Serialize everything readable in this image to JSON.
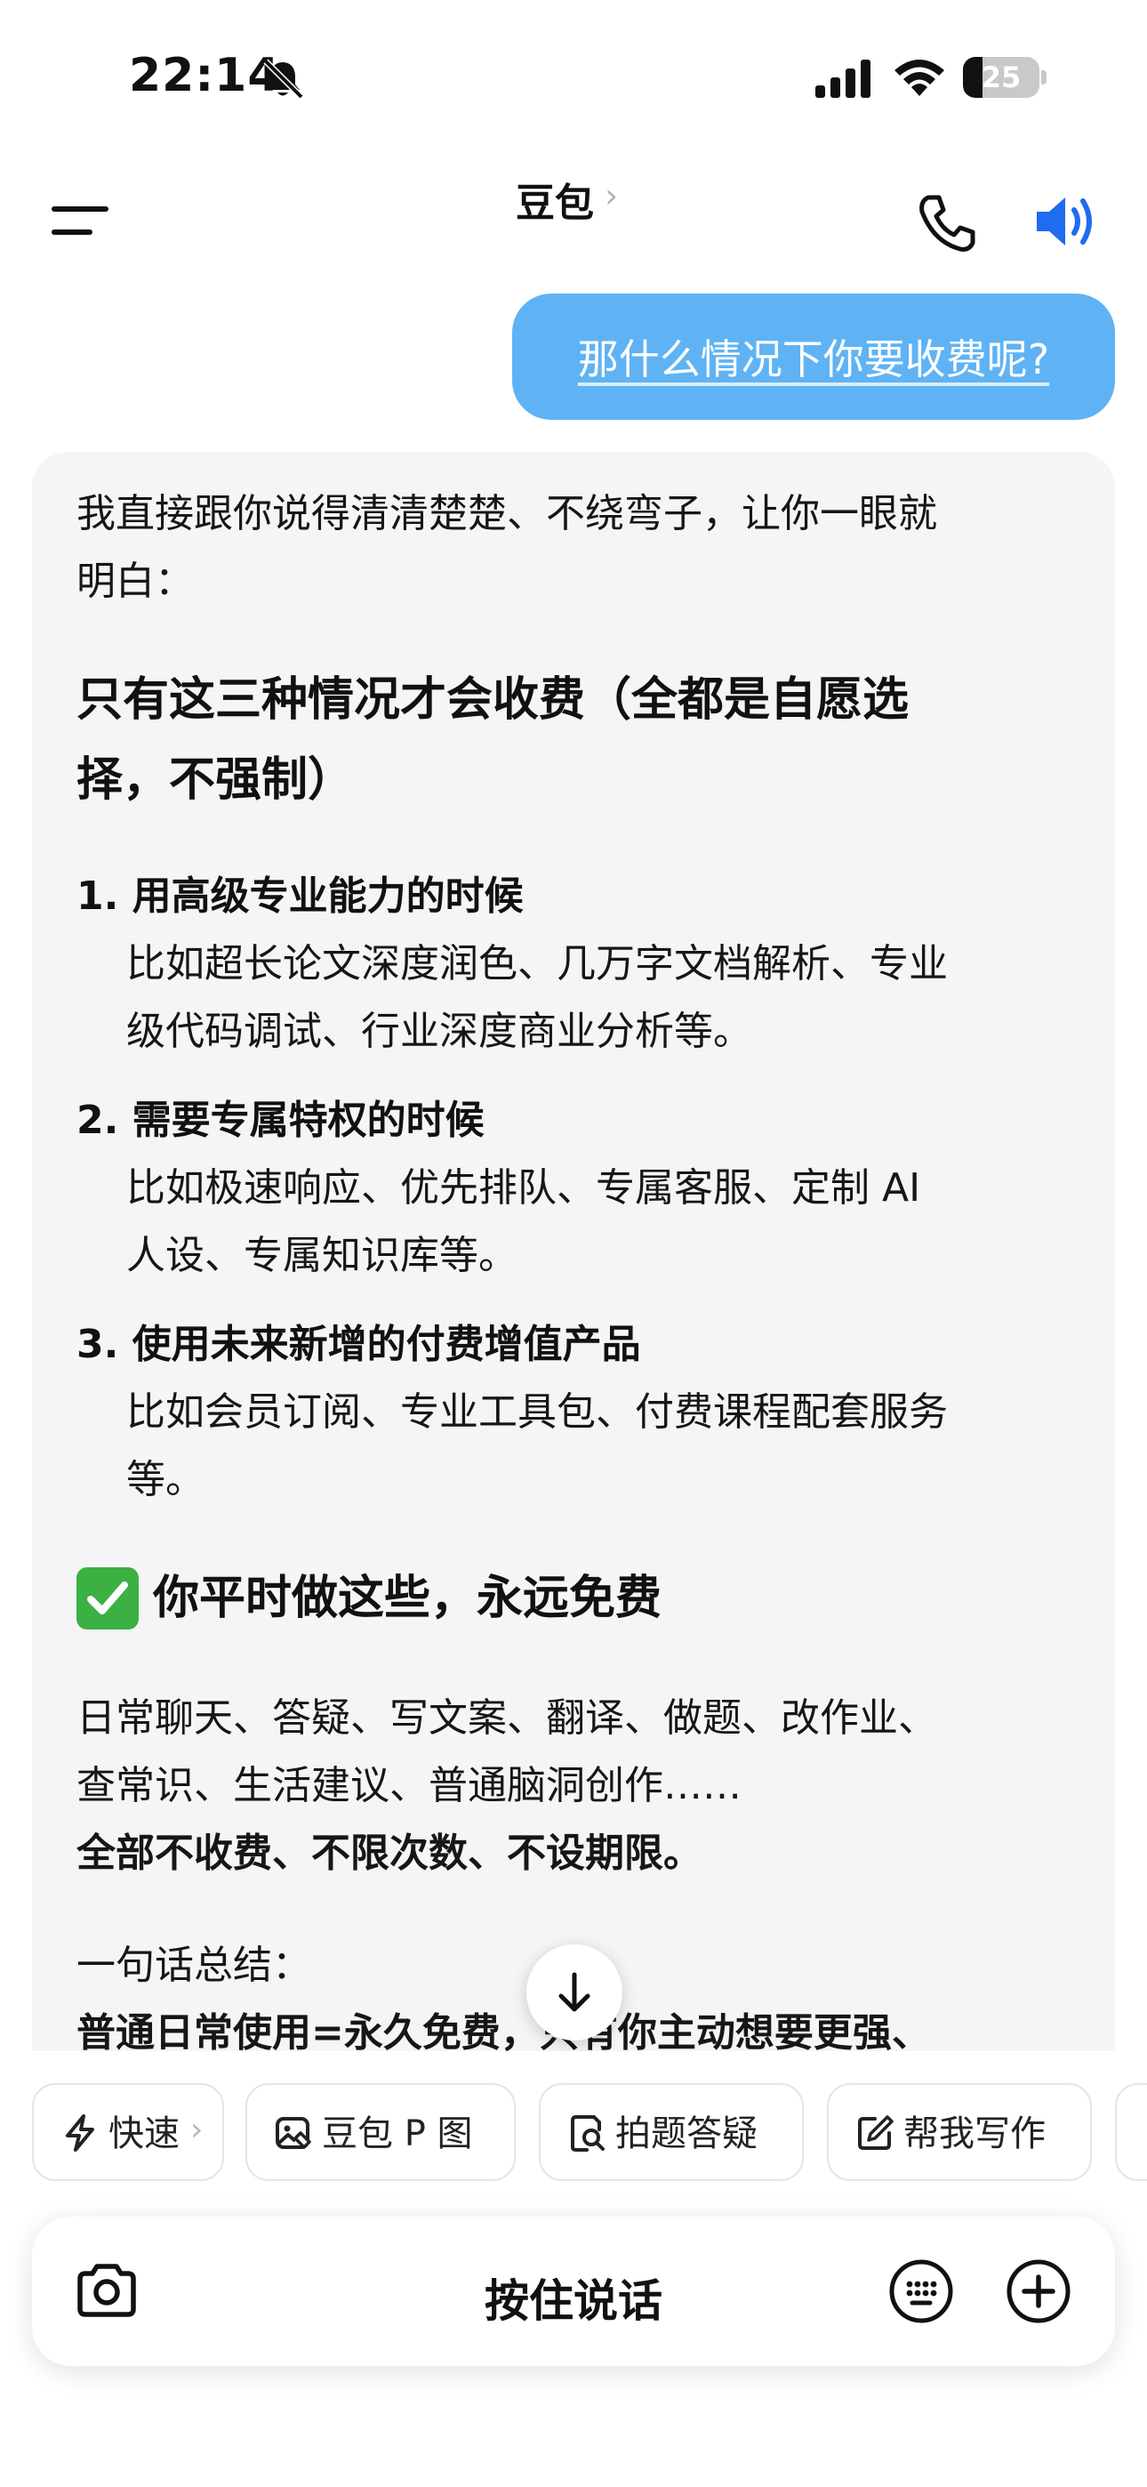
{
  "status_bar": {
    "time": "22:14",
    "battery_level": "25",
    "battery_fraction": 0.25,
    "icons": [
      "bell-off-icon",
      "cellular-signal-icon",
      "wifi-icon",
      "battery-icon"
    ]
  },
  "header": {
    "title": "豆包",
    "chevron": "›",
    "icons": [
      "menu-icon",
      "phone-icon",
      "speaker-icon"
    ],
    "accent_color": "#1e6cf0"
  },
  "user_message": {
    "text": "那什么情况下你要收费呢?",
    "bubble_color": "#5fb3f4"
  },
  "reply": {
    "intro_line1": "我直接跟你说得清清楚楚、不绕弯子，让你一眼就",
    "intro_line2": "明白：",
    "heading1_line1": "只有这三种情况才会收费（全都是自愿选",
    "heading1_line2": "择，不强制）",
    "items": [
      {
        "number": "1.",
        "title": "用高级专业能力的时候",
        "body_line1": "比如超长论文深度润色、几万字文档解析、专业",
        "body_line2": "级代码调试、行业深度商业分析等。"
      },
      {
        "number": "2.",
        "title": "需要专属特权的时候",
        "body_line1": "比如极速响应、优先排队、专属客服、定制 AI",
        "body_line2": "人设、专属知识库等。"
      },
      {
        "number": "3.",
        "title": "使用未来新增的付费增值产品",
        "body_line1": "比如会员订阅、专业工具包、付费课程配套服务",
        "body_line2": "等。"
      }
    ],
    "heading2": "你平时做这些，永远免费",
    "heading2_icon": "check-mark-icon",
    "free_line1": "日常聊天、答疑、写文案、翻译、做题、改作业、",
    "free_line2": "查常识、生活建议、普通脑洞创作……",
    "free_line3": "全部不收费、不限次数、不设期限。",
    "summary_label": "一句话总结：",
    "summary_line": "普通日常使用=永久免费，只有你主动想要更强、"
  },
  "scroll_button_icon": "arrow-down-icon",
  "chips": [
    {
      "label": "快速",
      "icon": "lightning-icon",
      "chevron": "›"
    },
    {
      "label": "豆包 P 图",
      "icon": "image-edit-icon"
    },
    {
      "label": "拍题答疑",
      "icon": "doc-search-icon"
    },
    {
      "label": "帮我写作",
      "icon": "pencil-icon"
    }
  ],
  "input_bar": {
    "label": "按住说话",
    "icons": [
      "camera-icon",
      "keyboard-icon",
      "plus-icon"
    ]
  }
}
